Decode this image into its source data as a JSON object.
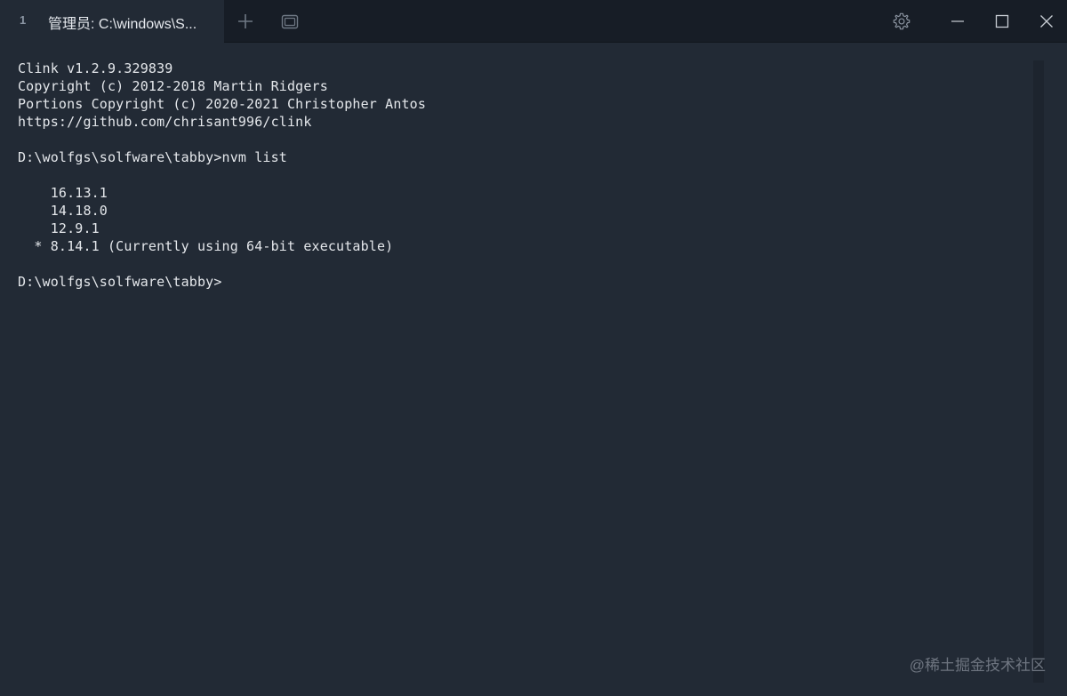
{
  "tab": {
    "index": "1",
    "title": "管理员: C:\\windows\\S..."
  },
  "icons": {
    "new_tab": "plus-icon",
    "tab_overview": "window-stack-icon",
    "settings": "gear-icon",
    "minimize": "minimize-icon",
    "maximize": "maximize-icon",
    "close": "close-icon"
  },
  "terminal": {
    "lines": [
      "Clink v1.2.9.329839",
      "Copyright (c) 2012-2018 Martin Ridgers",
      "Portions Copyright (c) 2020-2021 Christopher Antos",
      "https://github.com/chrisant996/clink",
      "",
      "D:\\wolfgs\\solfware\\tabby>nvm list",
      "",
      "    16.13.1",
      "    14.18.0",
      "    12.9.1",
      "  * 8.14.1 (Currently using 64-bit executable)",
      "",
      "D:\\wolfgs\\solfware\\tabby>"
    ]
  },
  "watermark": "@稀土掘金技术社区",
  "colors": {
    "titlebar": "#171d26",
    "terminal_bg": "#222a35",
    "terminal_fg": "#e4e7eb"
  }
}
